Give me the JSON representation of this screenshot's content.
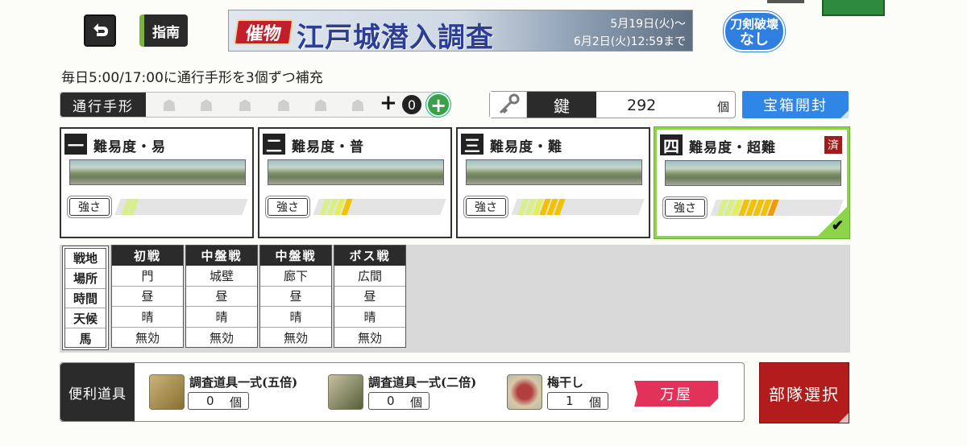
{
  "top": {
    "guide_label": "指南",
    "banner": {
      "tag": "催物",
      "title": "江戸城潜入調査",
      "date_start": "5月19日(火)～",
      "date_end": "6月2日(火)12:59まで"
    },
    "sword_break": {
      "line1": "刀剣破壊",
      "line2": "なし"
    }
  },
  "notice": "毎日5:00/17:00に通行手形を3個ずつ補充",
  "pass": {
    "label": "通行手形",
    "plus": "+",
    "count": "0",
    "add": "+"
  },
  "key": {
    "label": "鍵",
    "value": "292",
    "unit": "個"
  },
  "open_chest": "宝箱開封",
  "difficulties": [
    {
      "num": "一",
      "name": "難易度・易",
      "strength_label": "強さ",
      "strength": 1,
      "done": false
    },
    {
      "num": "二",
      "name": "難易度・普",
      "strength_label": "強さ",
      "strength": 2,
      "done": false
    },
    {
      "num": "三",
      "name": "難易度・難",
      "strength_label": "強さ",
      "strength": 3,
      "done": false
    },
    {
      "num": "四",
      "name": "難易度・超難",
      "strength_label": "強さ",
      "strength": 4,
      "done": true,
      "done_label": "済",
      "check": "✔"
    }
  ],
  "battle": {
    "row_headers": [
      "戦地",
      "場所",
      "時間",
      "天候",
      "馬"
    ],
    "columns": [
      {
        "header": "初戦",
        "place": "門",
        "time": "昼",
        "weather": "晴",
        "horse": "無効"
      },
      {
        "header": "中盤戦",
        "place": "城壁",
        "time": "昼",
        "weather": "晴",
        "horse": "無効"
      },
      {
        "header": "中盤戦",
        "place": "廊下",
        "time": "昼",
        "weather": "晴",
        "horse": "無効"
      },
      {
        "header": "ボス戦",
        "place": "広間",
        "time": "昼",
        "weather": "晴",
        "horse": "無効"
      }
    ]
  },
  "items": {
    "label": "便利道具",
    "list": [
      {
        "name": "調査道具一式(五倍)",
        "count": "0",
        "unit": "個"
      },
      {
        "name": "調査道具一式(二倍)",
        "count": "0",
        "unit": "個"
      },
      {
        "name": "梅干し",
        "count": "1",
        "unit": "個"
      }
    ],
    "shop": "万屋"
  },
  "unit_select": "部隊選択",
  "colors": {
    "accent_blue": "#2f86e6",
    "danger_red": "#b31c1c",
    "select_green": "#8cd44a",
    "strength_yellow": "#f2c200"
  }
}
